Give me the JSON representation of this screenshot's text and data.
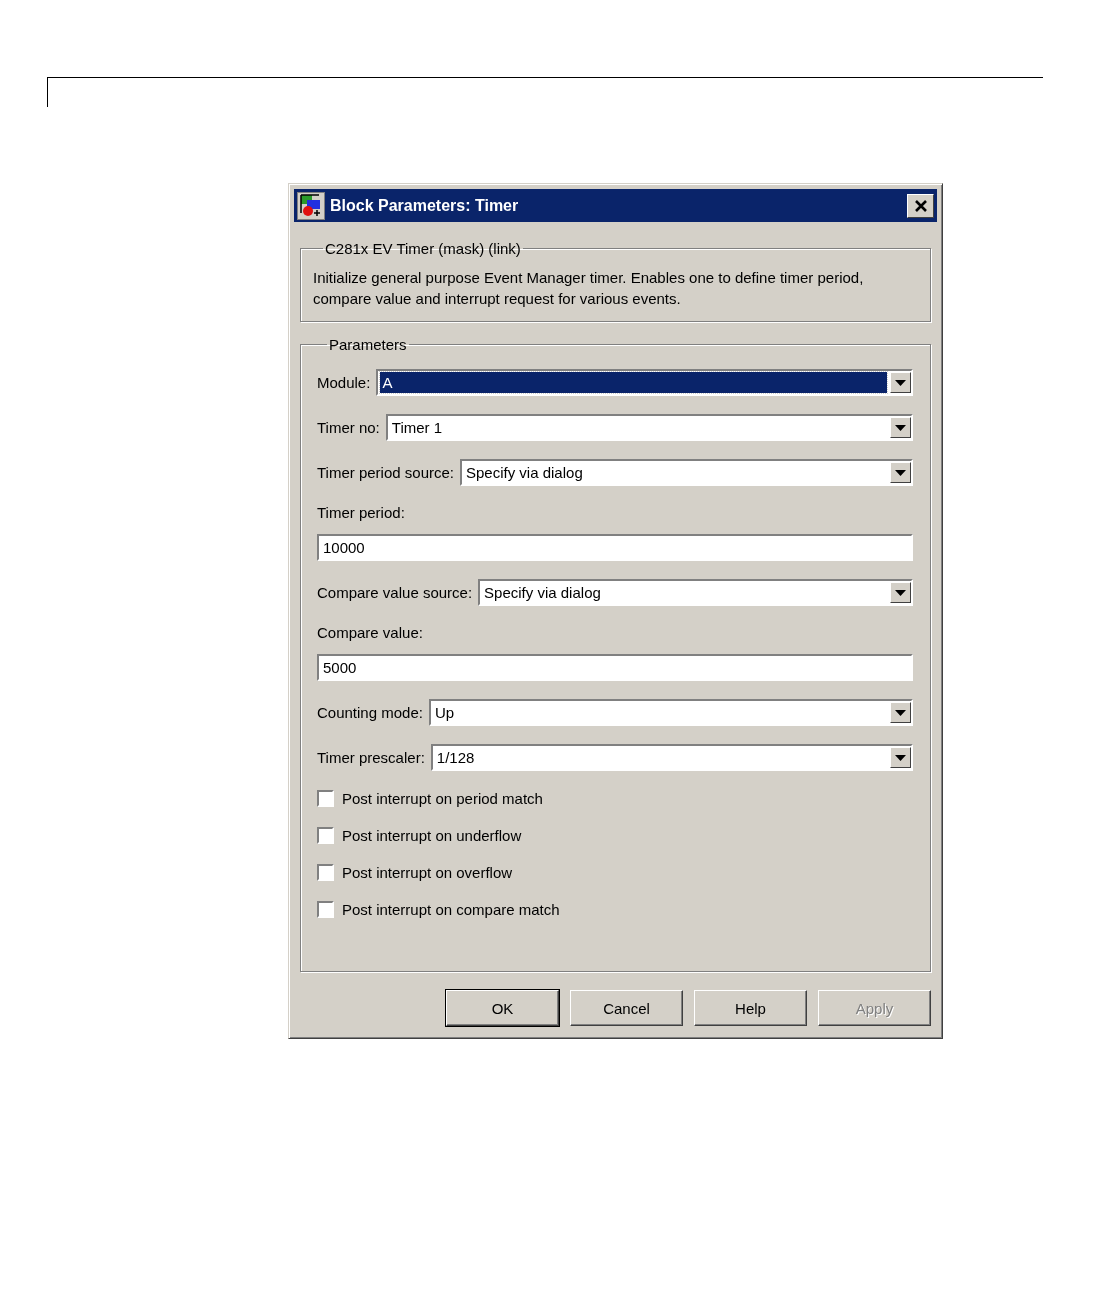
{
  "window": {
    "title": "Block Parameters: Timer"
  },
  "description": {
    "title": "C281x EV Timer (mask) (link)",
    "text": "Initialize general purpose Event Manager timer. Enables one to define timer period, compare value and interrupt request for various events."
  },
  "parameters": {
    "title": "Parameters",
    "fields": [
      {
        "kind": "dropdown",
        "label": "Module:",
        "value": "A",
        "focused": true
      },
      {
        "kind": "dropdown",
        "label": "Timer no:",
        "value": "Timer 1",
        "focused": false
      },
      {
        "kind": "dropdown",
        "label": "Timer period source:",
        "value": "Specify via dialog",
        "focused": false
      },
      {
        "kind": "text",
        "label": "Timer period:",
        "value": "10000",
        "focused": false
      },
      {
        "kind": "dropdown",
        "label": "Compare value source:",
        "value": "Specify via dialog",
        "focused": false
      },
      {
        "kind": "text",
        "label": "Compare value:",
        "value": "5000",
        "focused": false
      },
      {
        "kind": "dropdown",
        "label": "Counting mode:",
        "value": "Up",
        "focused": false
      },
      {
        "kind": "dropdown",
        "label": "Timer prescaler:",
        "value": "1/128",
        "focused": false
      },
      {
        "kind": "checkbox",
        "label": "Post interrupt on period match",
        "checked": false
      },
      {
        "kind": "checkbox",
        "label": "Post interrupt on underflow",
        "checked": false
      },
      {
        "kind": "checkbox",
        "label": "Post interrupt on overflow",
        "checked": false
      },
      {
        "kind": "checkbox",
        "label": "Post interrupt on compare match",
        "checked": false
      }
    ]
  },
  "buttons": [
    {
      "label": "OK",
      "default": true,
      "disabled": false
    },
    {
      "label": "Cancel",
      "default": false,
      "disabled": false
    },
    {
      "label": "Help",
      "default": false,
      "disabled": false
    },
    {
      "label": "Apply",
      "default": false,
      "disabled": true
    }
  ]
}
